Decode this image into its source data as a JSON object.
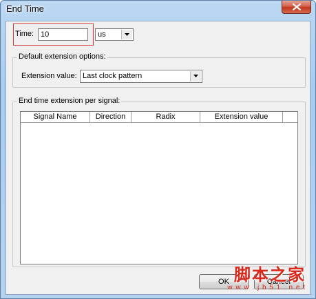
{
  "window": {
    "title": "End Time"
  },
  "time": {
    "label": "Time:",
    "value": "10",
    "unit": "us"
  },
  "default_ext": {
    "group_title": "Default extension options:",
    "label": "Extension value:",
    "selected": "Last clock pattern"
  },
  "per_signal": {
    "group_title": "End time extension per signal:",
    "columns": [
      "Signal Name",
      "Direction",
      "Radix",
      "Extension value"
    ]
  },
  "buttons": {
    "ok": "OK",
    "cancel": "Cancel"
  },
  "watermark": {
    "main": "脚本之家",
    "sub": "w w w . j b 5 1 . n e t"
  },
  "colors": {
    "highlight": "#d23a3a",
    "watermark": "#d9281c",
    "close_button": "#c1361e"
  }
}
